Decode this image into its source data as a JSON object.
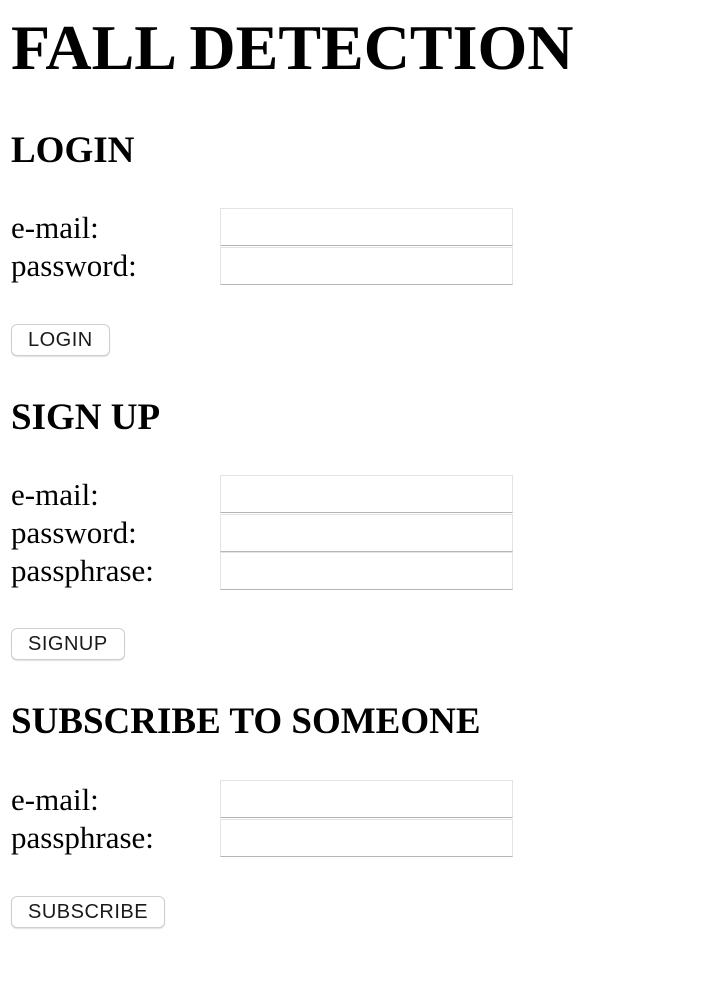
{
  "app": {
    "title": "FALL DETECTION"
  },
  "login": {
    "heading": "LOGIN",
    "email_label": "e-mail:",
    "email_value": "",
    "password_label": "password:",
    "password_value": "",
    "button_label": "LOGIN"
  },
  "signup": {
    "heading": "SIGN UP",
    "email_label": "e-mail:",
    "email_value": "",
    "password_label": "password:",
    "password_value": "",
    "passphrase_label": "passphrase:",
    "passphrase_value": "",
    "button_label": "SIGNUP"
  },
  "subscribe": {
    "heading": "SUBSCRIBE TO SOMEONE",
    "email_label": "e-mail:",
    "email_value": "",
    "passphrase_label": "passphrase:",
    "passphrase_value": "",
    "button_label": "SUBSCRIBE"
  }
}
